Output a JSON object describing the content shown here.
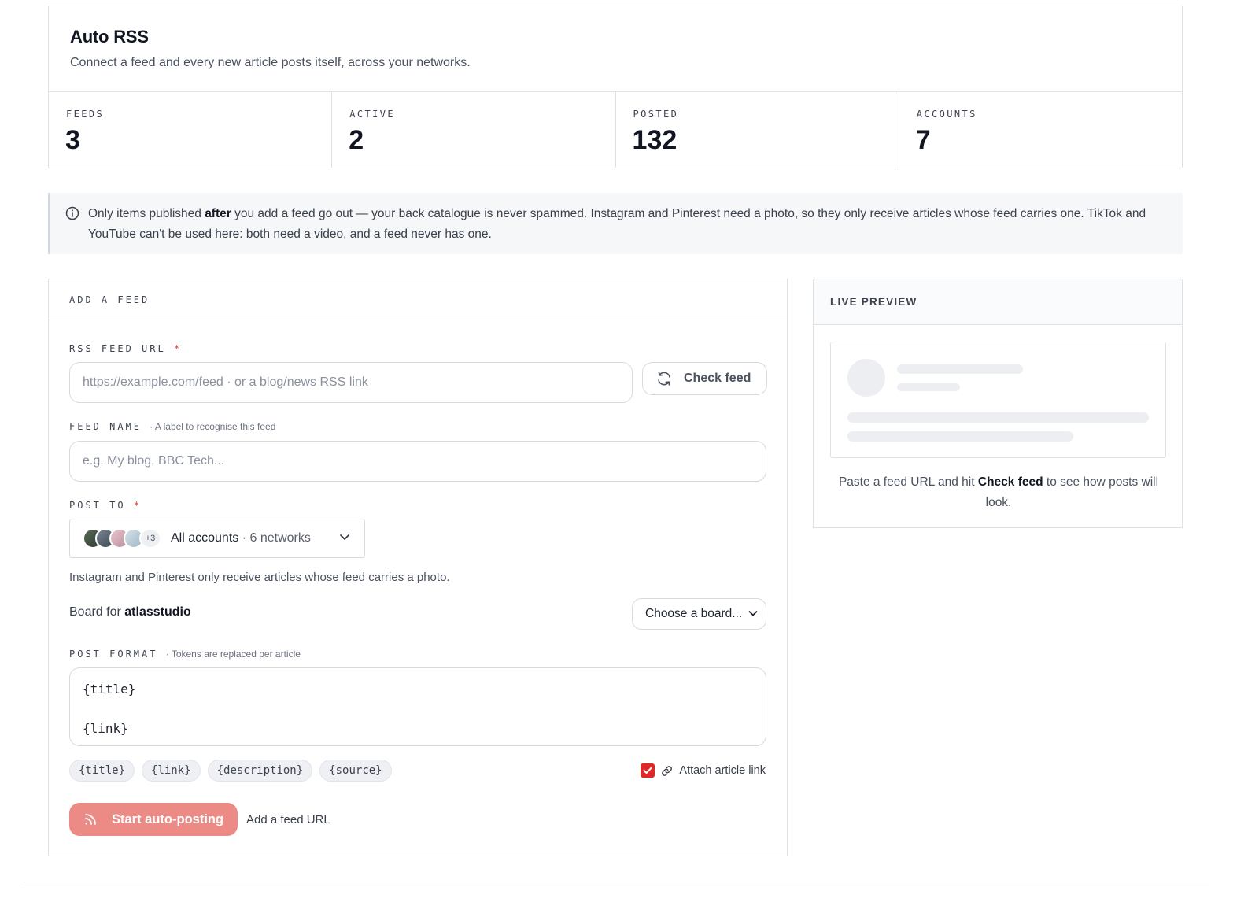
{
  "header": {
    "title": "Auto RSS",
    "subtitle": "Connect a feed and every new article posts itself, across your networks."
  },
  "stats": [
    {
      "label": "FEEDS",
      "value": "3"
    },
    {
      "label": "ACTIVE",
      "value": "2"
    },
    {
      "label": "POSTED",
      "value": "132"
    },
    {
      "label": "ACCOUNTS",
      "value": "7"
    }
  ],
  "notice": {
    "pre": "Only items published ",
    "strong": "after",
    "post": " you add a feed go out — your back catalogue is never spammed. Instagram and Pinterest need a photo, so they only receive articles whose feed carries one. TikTok and YouTube can't be used here: both need a video, and a feed never has one."
  },
  "add_feed": {
    "heading": "ADD A FEED",
    "url_label": "RSS FEED URL",
    "required_mark": "*",
    "url_placeholder": "https://example.com/feed  ·  or a blog/news RSS link",
    "check_button": "Check feed",
    "name_label": "FEED NAME",
    "name_hint": "· A label to recognise this feed",
    "name_placeholder": "e.g. My blog, BBC Tech...",
    "post_to_label": "POST TO",
    "accounts_more": "+3",
    "accounts_main": "All accounts",
    "accounts_sub": " · 6 networks",
    "photo_note": "Instagram and Pinterest only receive articles whose feed carries a photo.",
    "board_prefix": "Board for ",
    "board_account": "atlasstudio",
    "board_select": "Choose a board...",
    "format_label": "POST FORMAT",
    "format_hint": "· Tokens are replaced per article",
    "format_lines": [
      "{title}",
      "",
      "{link}"
    ],
    "tokens": [
      "{title}",
      "{link}",
      "{description}",
      "{source}"
    ],
    "attach_label": "Attach article link",
    "attach_checked": true,
    "start_button": "Start auto-posting",
    "start_hint": "Add a feed URL"
  },
  "preview": {
    "title": "LIVE PREVIEW",
    "msg_pre": "Paste a feed URL and hit ",
    "msg_strong": "Check feed",
    "msg_post": " to see how posts will look."
  },
  "colors": {
    "accent": "#dc2a2a",
    "start_button_bg": "#ec8b86",
    "notice_bg": "#f5f7f9",
    "border": "#dfe2e6"
  },
  "icons": {
    "notice": "info-icon",
    "check": "refresh-icon",
    "accounts": "chevron-down-icon",
    "attach": "link-icon",
    "start": "rss-icon"
  }
}
